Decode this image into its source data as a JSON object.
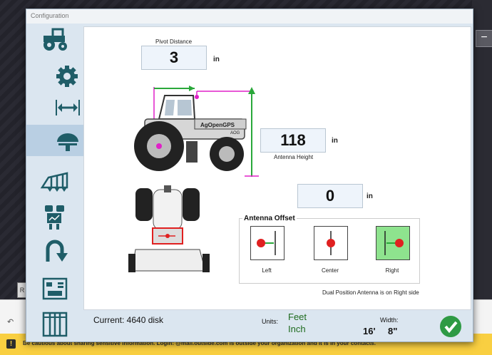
{
  "window": {
    "title": "Configuration"
  },
  "sidebar": {
    "items": [
      {
        "name": "tractor-icon"
      },
      {
        "name": "gear-icon"
      },
      {
        "name": "width-arrows-icon"
      },
      {
        "name": "gps-antenna-icon",
        "selected": true
      },
      {
        "name": "tool-hitch-icon"
      },
      {
        "name": "sections-icon"
      },
      {
        "name": "u-turn-icon"
      },
      {
        "name": "module-board-icon"
      },
      {
        "name": "grid-columns-icon"
      }
    ]
  },
  "antenna": {
    "pivot_label": "Pivot Distance",
    "pivot_value": "3",
    "pivot_unit": "in",
    "height_value": "118",
    "height_unit": "in",
    "height_label": "Antenna Height",
    "offset_value": "0",
    "offset_unit": "in",
    "offset_group_title": "Antenna Offset",
    "left_label": "Left",
    "center_label": "Center",
    "right_label": "Right",
    "selected": "Right",
    "dual_note": "Dual Position Antenna is on Right side",
    "tractor_brand": "AgOpenGPS",
    "tractor_model": "AOG"
  },
  "footer": {
    "current": "Current: 4640 disk",
    "units_label": "Units:",
    "unit_feet": "Feet",
    "unit_inch": "Inch",
    "width_label": "Width:",
    "width_feet": "16'",
    "width_inch": "8\""
  },
  "background": {
    "notice_text": "Be cautious about sharing sensitive information. Login: @mail.outside.com is outside your organization and it is in your contacts.",
    "r_button": "R",
    "minus_button": "−"
  },
  "colors": {
    "accent": "#b9cfe3",
    "ok_green": "#2e9a44",
    "feet_inch_green": "#1e6b1e",
    "notice": "#f9cf41"
  }
}
